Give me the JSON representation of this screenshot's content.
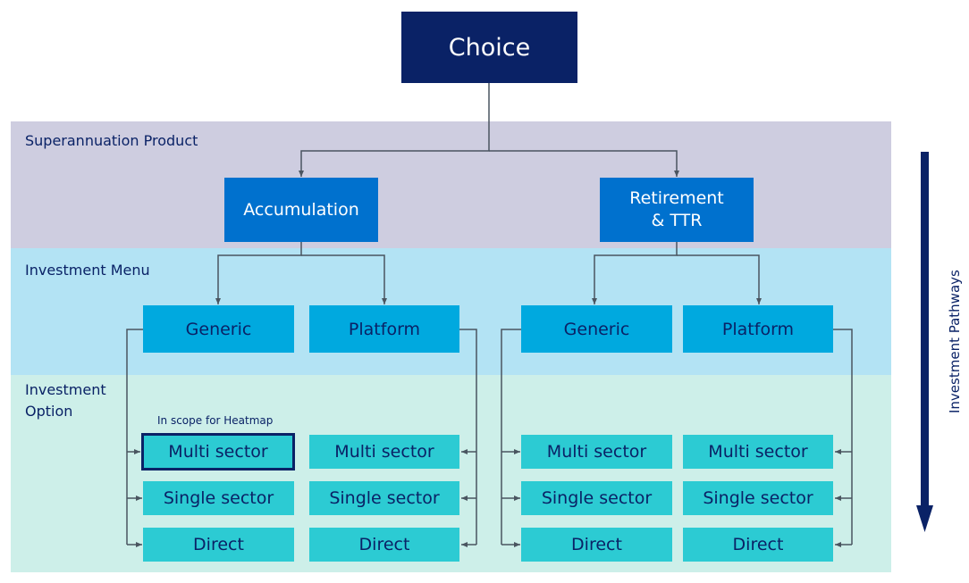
{
  "top": {
    "label": "Choice"
  },
  "bands": [
    {
      "label": "Superannuation Product",
      "color": "#cecde0"
    },
    {
      "label": "Investment Menu",
      "color": "#b3e3f4"
    },
    {
      "label": "Investment\nOption",
      "line1": "Investment",
      "line2": "Option",
      "color": "#cdefe9"
    }
  ],
  "products": [
    {
      "label": "Accumulation"
    },
    {
      "label_line1": "Retirement",
      "label_line2": "& TTR"
    }
  ],
  "menus": [
    {
      "label": "Generic"
    },
    {
      "label": "Platform"
    },
    {
      "label": "Generic"
    },
    {
      "label": "Platform"
    }
  ],
  "options": {
    "labels": [
      "Multi sector",
      "Single sector",
      "Direct"
    ],
    "columns": [
      [
        "Multi sector",
        "Single sector",
        "Direct"
      ],
      [
        "Multi sector",
        "Single sector",
        "Direct"
      ],
      [
        "Multi sector",
        "Single sector",
        "Direct"
      ],
      [
        "Multi sector",
        "Single sector",
        "Direct"
      ]
    ]
  },
  "highlight_note": "In scope for Heatmap",
  "pathway": {
    "label": "Investment Pathways",
    "icon": "down-arrow-icon"
  },
  "colors": {
    "navy": "#0a2266",
    "product": "#0071ce",
    "menu": "#00a9df",
    "option": "#2ccbd3",
    "connector": "#4a5560"
  }
}
